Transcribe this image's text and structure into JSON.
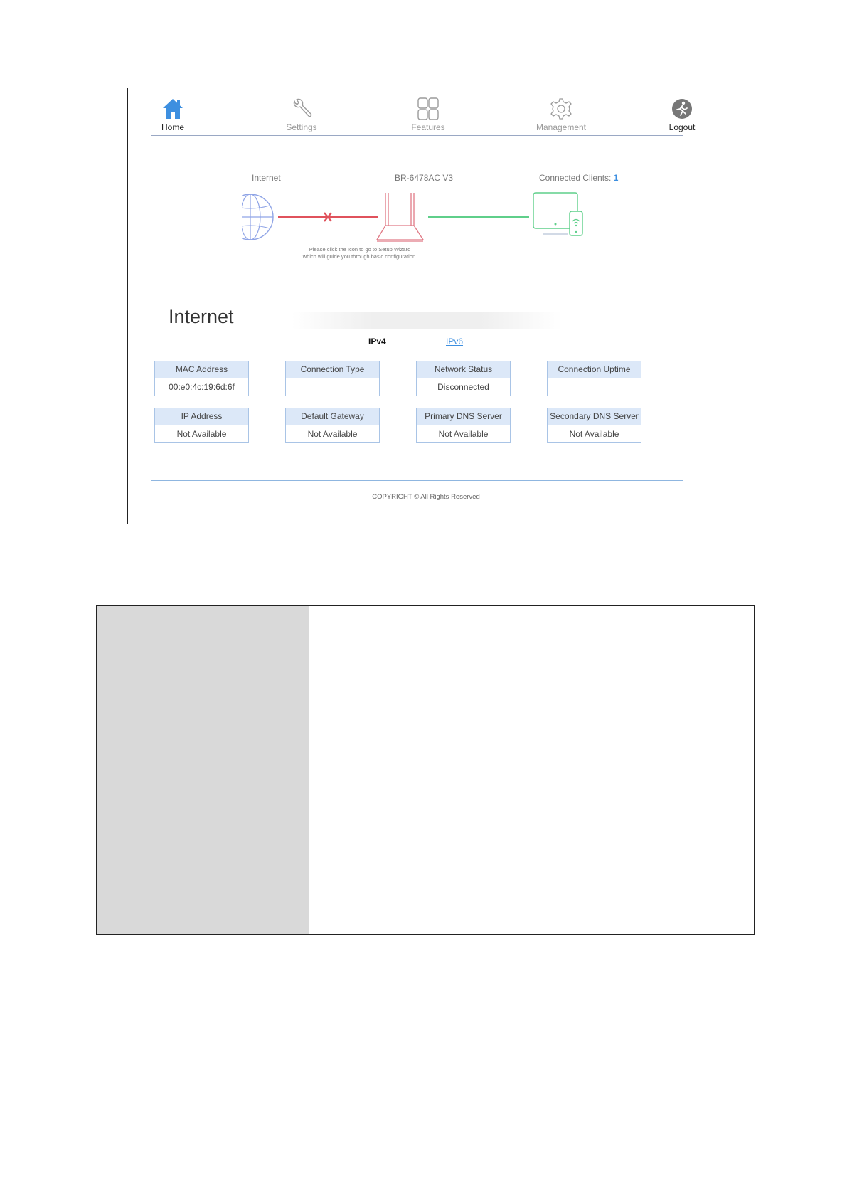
{
  "nav": {
    "items": [
      {
        "label": "Home",
        "icon": "home-icon"
      },
      {
        "label": "Settings",
        "icon": "wrench-icon"
      },
      {
        "label": "Features",
        "icon": "grid-icon"
      },
      {
        "label": "Management",
        "icon": "gear-icon"
      },
      {
        "label": "Logout",
        "icon": "logout-icon"
      }
    ],
    "active": "Home"
  },
  "diagram": {
    "internet_label": "Internet",
    "device_label": "BR-6478AC V3",
    "clients_label": "Connected Clients:",
    "clients_count": "1",
    "hint_line1": "Please click the Icon to go to Setup Wizard",
    "hint_line2": "which will guide you through basic configuration.",
    "colors": {
      "globe": "#8fa4e6",
      "disconnected": "#e0525c",
      "router": "#e07a86",
      "connected": "#5fcf8a"
    }
  },
  "internet": {
    "title": "Internet",
    "tabs": [
      {
        "label": "IPv4"
      },
      {
        "label": "IPv6"
      }
    ],
    "cards": [
      {
        "label": "MAC Address",
        "value": "00:e0:4c:19:6d:6f"
      },
      {
        "label": "Connection Type",
        "value": ""
      },
      {
        "label": "Network Status",
        "value": "Disconnected"
      },
      {
        "label": "Connection Uptime",
        "value": ""
      },
      {
        "label": "IP Address",
        "value": "Not Available"
      },
      {
        "label": "Default Gateway",
        "value": "Not Available"
      },
      {
        "label": "Primary DNS Server",
        "value": "Not Available"
      },
      {
        "label": "Secondary DNS Server",
        "value": "Not Available"
      }
    ]
  },
  "footer": {
    "copyright": "COPYRIGHT © All Rights Reserved"
  },
  "accent_color": "#3d8fe0"
}
